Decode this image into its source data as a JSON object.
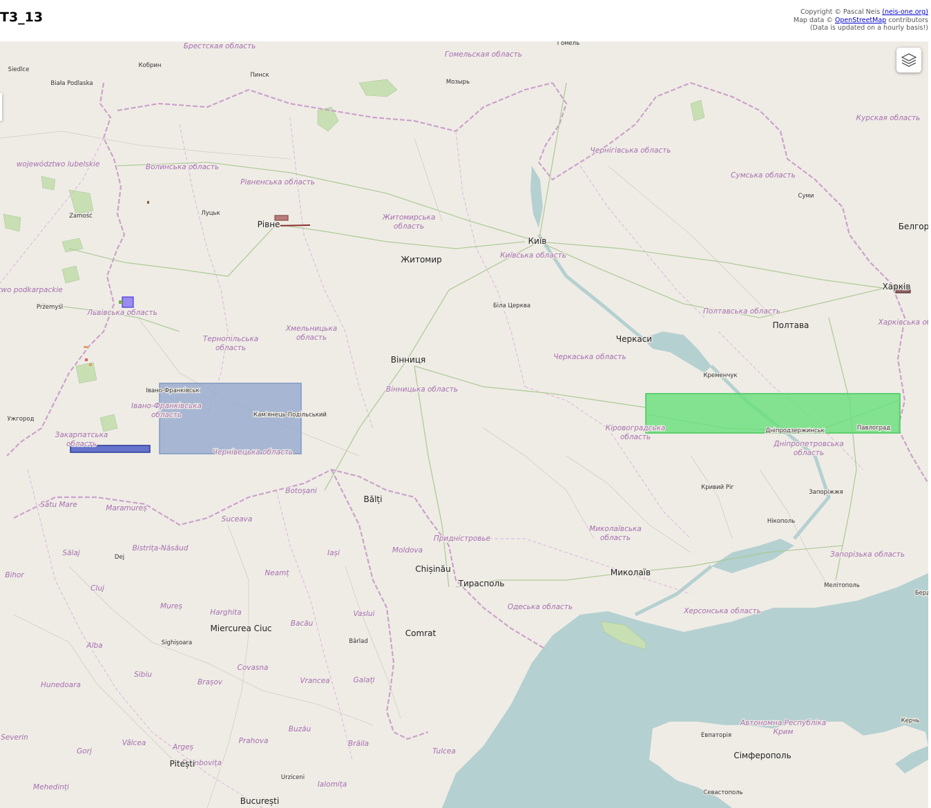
{
  "page_title": "T3_13",
  "attribution": {
    "line1_prefix": "Copyright © Pascal Neis ",
    "line1_link": "(neis-one.org)",
    "line2_prefix": "Map data © ",
    "line2_link": "OpenStreetMap",
    "line2_suffix": " contributors",
    "line3": "(Data is updated on a hourly basis!)"
  },
  "layers_control": {
    "icon": "layers-icon"
  },
  "colors": {
    "land": "#efece6",
    "sea": "#b5d0d0",
    "admin_border": "#c79ac7",
    "green_area": "#c8dfb3",
    "rect_blue": "#8fa6cc",
    "rect_green": "#66e07a",
    "rect_darkblue": "#5567c7",
    "rect_red": "#b97d7d",
    "rect_violet": "#8a7cf0"
  },
  "region_labels": [
    "Брестская область",
    "Гомельская область",
    "Курская область",
    "Чернігівська область",
    "Сумська область",
    "województwo lubelskie",
    "Волинська область",
    "Рівненська область",
    "Житомирська",
    "область",
    "Київська область",
    "Полтавська область",
    "Харківська об",
    "Черкаська область",
    "two podkarpackie",
    "Львівська область",
    "Тернопільська",
    "область",
    "Хмельницька",
    "область",
    "Вінницька область",
    "Івано-Франківська",
    "область",
    "Закарпатська",
    "область",
    "Чернівецька область",
    "Кіровоградська",
    "область",
    "Дніпропетровська",
    "область",
    "Миколаївська",
    "область",
    "Запорізька область",
    "Херсонська область",
    "Одеська область",
    "Автономна Республіка",
    "Крим",
    "Придністровье",
    "Botoșani",
    "Suceava",
    "Maramureș",
    "Satu Mare",
    "Sălaj",
    "Bistrița-Năsăud",
    "Iași",
    "Moldova",
    "Neamț",
    "Bihor",
    "Cluj",
    "Mureș",
    "Harghita",
    "Bacău",
    "Vaslui",
    "Alba",
    "Covasna",
    "Vrancea",
    "Galați",
    "Sibiu",
    "Hunedoara",
    "Brașov",
    "Buzău",
    "Brăila",
    "Tulcea",
    "Severin",
    "Vâlcea",
    "Argeș",
    "Prahova",
    "Gorj",
    "Dâmbovița",
    "Ialomița",
    "Mehedinți"
  ],
  "city_labels": [
    "Гомель",
    "Кобрин",
    "Siedlce",
    "Biała Podlaska",
    "Пинск",
    "Мозырь",
    "Луцьк",
    "Zamość",
    "Рівне",
    "Житомир",
    "Київ",
    "Суми",
    "Белгор",
    "Przemyśl",
    "Біла Церква",
    "Харків",
    "Полтава",
    "Черкаси",
    "Вінниця",
    "Івано-Франківськ",
    "Кременчук",
    "Ужгород",
    "Кам'янець-Подільський",
    "Павлоград",
    "Дніпродзержинськ",
    "Кривий Ріг",
    "Запоріжжя",
    "Bălți",
    "Нікополь",
    "Chișinău",
    "Миколаїв",
    "Тирасполь",
    "Мелітополь",
    "Берд",
    "Dej",
    "Miercurea Ciuc",
    "Comrat",
    "Sighișoara",
    "Bârlad",
    "Евпаторія",
    "Сімферополь",
    "Керчь",
    "Севастополь",
    "Pitești",
    "Urziceni",
    "București"
  ]
}
